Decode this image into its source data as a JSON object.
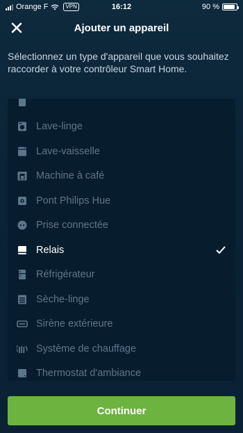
{
  "status_bar": {
    "carrier": "Orange F",
    "vpn_label": "VPN",
    "time": "16:12",
    "battery_text": "90 %",
    "battery_level": 0.9
  },
  "header": {
    "title": "Ajouter un appareil",
    "close_icon": "close-icon"
  },
  "intro_text": "Sélectionnez un type d'appareil que vous souhaitez raccorder à votre contrôleur Smart Home.",
  "device_list": {
    "items": [
      {
        "label": "",
        "icon": "partial-item-icon",
        "selected": false
      },
      {
        "label": "Lave-linge",
        "icon": "washing-machine-icon",
        "selected": false
      },
      {
        "label": "Lave-vaisselle",
        "icon": "dishwasher-icon",
        "selected": false
      },
      {
        "label": "Machine à café",
        "icon": "coffee-machine-icon",
        "selected": false
      },
      {
        "label": "Pont Philips Hue",
        "icon": "hue-bridge-icon",
        "selected": false
      },
      {
        "label": "Prise connectée",
        "icon": "smart-plug-icon",
        "selected": false
      },
      {
        "label": "Relais",
        "icon": "relay-icon",
        "selected": true
      },
      {
        "label": "Réfrigérateur",
        "icon": "fridge-icon",
        "selected": false
      },
      {
        "label": "Sèche-linge",
        "icon": "dryer-icon",
        "selected": false
      },
      {
        "label": "Sirène extérieure",
        "icon": "siren-icon",
        "selected": false
      },
      {
        "label": "Système de chauffage",
        "icon": "heating-icon",
        "selected": false
      },
      {
        "label": "Thermostat d'ambiance",
        "icon": "thermostat-icon",
        "selected": false
      }
    ]
  },
  "continue_label": "Continuer",
  "colors": {
    "accent_green": "#6db33f",
    "dim_text": "#5c7689",
    "list_bg": "#071d2d",
    "bg": "#0a2335"
  }
}
